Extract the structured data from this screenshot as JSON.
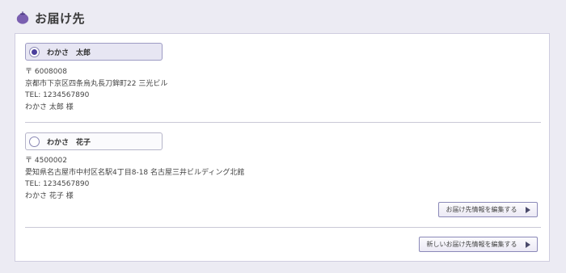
{
  "header": {
    "title": "お届け先",
    "icon": "tomato-icon",
    "icon_color": "#7a5fb0"
  },
  "addresses": [
    {
      "name": "わかさ　太郎",
      "selected": true,
      "postal": "〒 6008008",
      "address": "京都市下京区四条烏丸長刀鉾町22 三光ビル",
      "tel": "TEL: 1234567890",
      "recipient": "わかさ 太郎 様"
    },
    {
      "name": "わかさ　花子",
      "selected": false,
      "postal": "〒 4500002",
      "address": "愛知県名古屋市中村区名駅4丁目8-18 名古屋三井ビルディング北館",
      "tel": "TEL: 1234567890",
      "recipient": "わかさ 花子 様",
      "edit_label": "お届け先情報を編集する"
    }
  ],
  "new_address_label": "新しいお届け先情報を編集する",
  "colors": {
    "accent": "#4b3f9c",
    "background": "#ecebf3",
    "border": "#9d9bc4"
  }
}
